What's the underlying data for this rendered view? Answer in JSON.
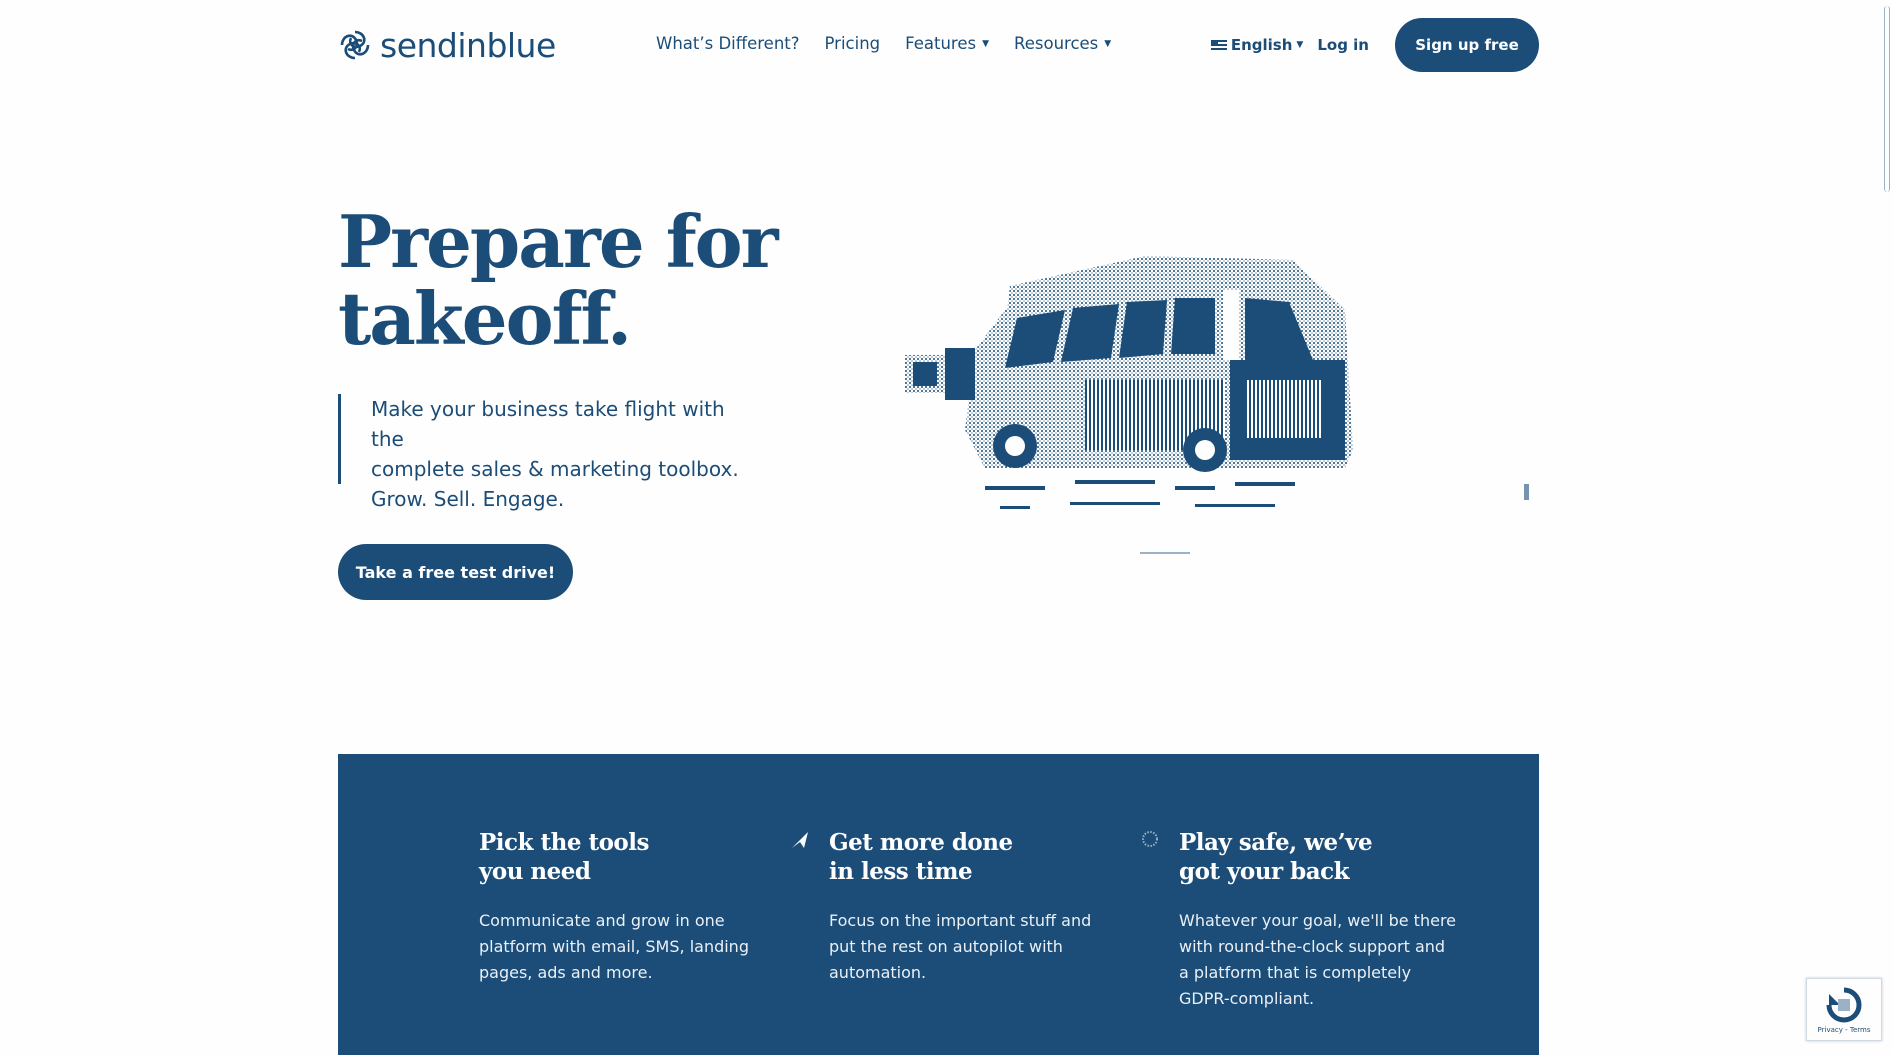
{
  "brand": {
    "name": "sendinblue",
    "color": "#1b4d78",
    "logo_icon": "sendinblue-swirl-icon"
  },
  "nav": {
    "items": [
      {
        "label": "What’s Different?",
        "has_caret": false
      },
      {
        "label": "Pricing",
        "has_caret": false
      },
      {
        "label": "Features",
        "has_caret": true
      },
      {
        "label": "Resources",
        "has_caret": true
      }
    ]
  },
  "header_right": {
    "language": "English",
    "language_icon": "us-flag-icon",
    "login": "Log in",
    "signup": "Sign up free"
  },
  "hero": {
    "title_line1": "Prepare for",
    "title_line2": "takeoff.",
    "subtitle_line1": "Make your business take flight with the",
    "subtitle_line2": "complete sales & marketing toolbox.",
    "subtitle_line3": "Grow. Sell. Engage.",
    "cta": "Take a free test drive!",
    "illustration": "camper-van-illustration"
  },
  "features": [
    {
      "title_line1": "Pick the tools",
      "title_line2": "you need",
      "description": "Communicate and grow in one platform with email, SMS, landing pages, ads and more.",
      "icon": ""
    },
    {
      "title_line1": "Get more done",
      "title_line2": "in less time",
      "description": "Focus on the important stuff and put the rest on autopilot with automation.",
      "icon": "paper-plane-icon"
    },
    {
      "title_line1": "Play safe, we’ve",
      "title_line2": "got your back",
      "description": "Whatever your goal, we'll be there with round-the-clock support and a platform that is completely GDPR-compliant.",
      "icon": "dotted-circle-icon"
    }
  ],
  "recaptcha": {
    "text": "Privacy - Terms"
  }
}
